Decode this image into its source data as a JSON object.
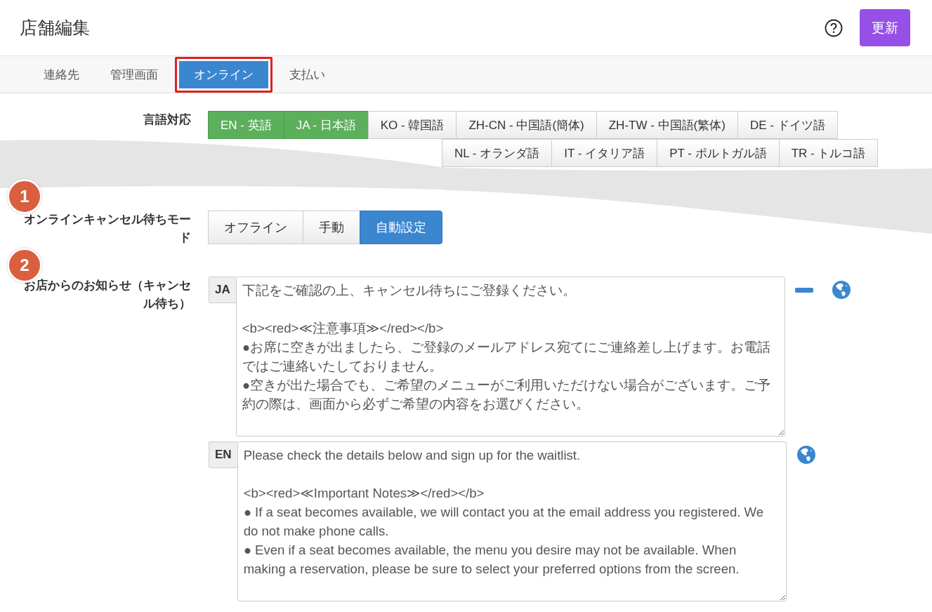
{
  "header": {
    "title": "店舗編集",
    "update_button": "更新"
  },
  "tabs": [
    {
      "label": "連絡先",
      "selected": false
    },
    {
      "label": "管理画面",
      "selected": false
    },
    {
      "label": "オンライン",
      "selected": true
    },
    {
      "label": "支払い",
      "selected": false
    }
  ],
  "languages": {
    "label": "言語対応",
    "options": [
      {
        "label": "EN - 英語",
        "selected": true
      },
      {
        "label": "JA - 日本語",
        "selected": true
      },
      {
        "label": "KO - 韓国語",
        "selected": false
      },
      {
        "label": "ZH-CN - 中国語(簡体)",
        "selected": false
      },
      {
        "label": "ZH-TW - 中国語(繁体)",
        "selected": false
      },
      {
        "label": "DE - ドイツ語",
        "selected": false
      },
      {
        "label": "NL - オランダ語",
        "selected": false
      },
      {
        "label": "IT - イタリア語",
        "selected": false
      },
      {
        "label": "PT - ポルトガル語",
        "selected": false
      },
      {
        "label": "TR - トルコ語",
        "selected": false
      }
    ]
  },
  "mode": {
    "step": "1",
    "label": "オンラインキャンセル待ちモード",
    "options": [
      {
        "label": "オフライン",
        "selected": false
      },
      {
        "label": "手動",
        "selected": false
      },
      {
        "label": "自動設定",
        "selected": true
      }
    ]
  },
  "notice": {
    "step": "2",
    "label": "お店からのお知らせ（キャンセル待ち）",
    "entries": [
      {
        "lang": "JA",
        "removable": true,
        "text": "下記をご確認の上、キャンセル待ちにご登録ください。\n\n<b><red>≪注意事項≫</red></b>\n●お席に空きが出ましたら、ご登録のメールアドレス宛てにご連絡差し上げます。お電話ではご連絡いたしておりません。\n●空きが出た場合でも、ご希望のメニューがご利用いただけない場合がございます。ご予約の際は、画面から必ずご希望の内容をお選びください。"
      },
      {
        "lang": "EN",
        "removable": false,
        "text": "Please check the details below and sign up for the waitlist.\n\n<b><red>≪Important Notes≫</red></b>\n● If a seat becomes available, we will contact you at the email address you registered. We do not make phone calls.\n● Even if a seat becomes available, the menu you desire may not be available. When making a reservation, please be sure to select your preferred options from the screen."
      }
    ]
  }
}
